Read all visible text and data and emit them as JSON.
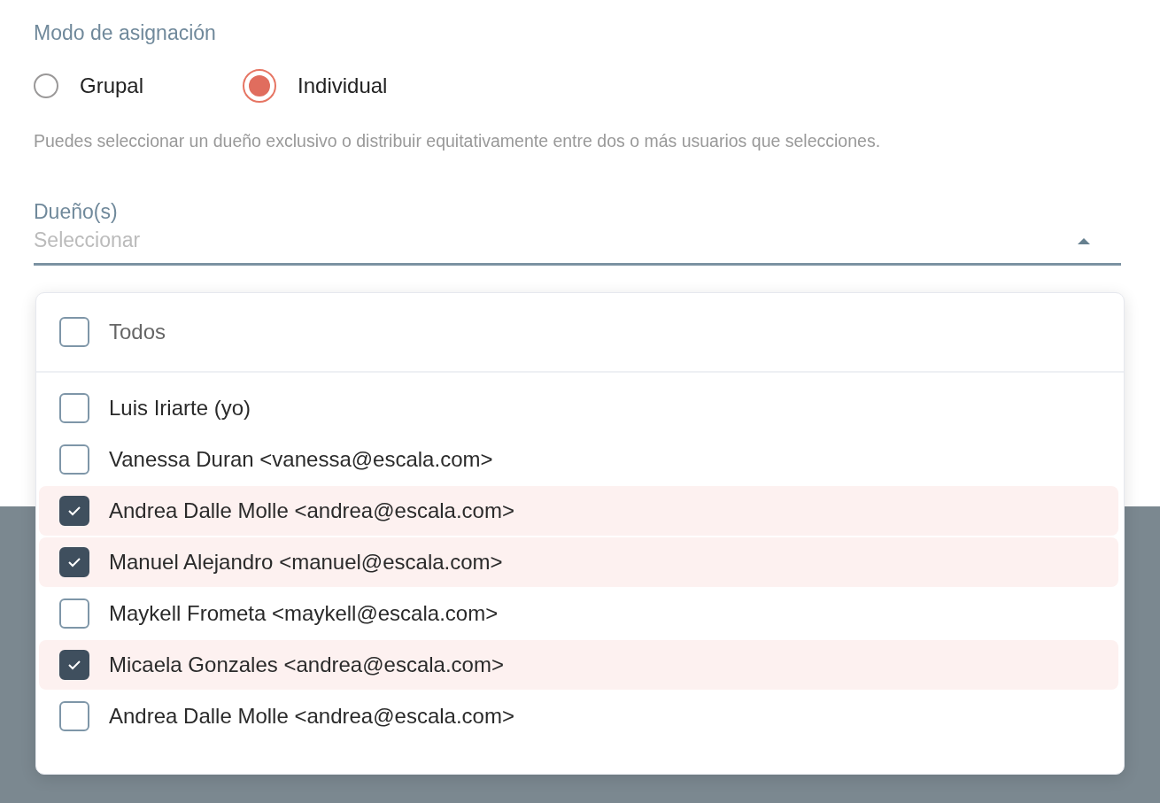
{
  "assignment_mode": {
    "label": "Modo de asignación",
    "options": [
      {
        "label": "Grupal",
        "selected": false
      },
      {
        "label": "Individual",
        "selected": true
      }
    ]
  },
  "help_text": "Puedes seleccionar un dueño exclusivo o distribuir equitativamente entre dos o más usuarios que selecciones.",
  "owners_field": {
    "label": "Dueño(s)",
    "placeholder": "Seleccionar",
    "expanded": true
  },
  "dropdown": {
    "select_all": {
      "label": "Todos",
      "checked": false
    },
    "options": [
      {
        "label": "Luis Iriarte (yo)",
        "checked": false
      },
      {
        "label": "Vanessa Duran <vanessa@escala.com>",
        "checked": false
      },
      {
        "label": "Andrea Dalle Molle <andrea@escala.com>",
        "checked": true
      },
      {
        "label": "Manuel Alejandro <manuel@escala.com>",
        "checked": true
      },
      {
        "label": "Maykell Frometa <maykell@escala.com>",
        "checked": false
      },
      {
        "label": "Micaela Gonzales <andrea@escala.com>",
        "checked": true
      },
      {
        "label": "Andrea Dalle Molle <andrea@escala.com>",
        "checked": false
      }
    ]
  }
}
